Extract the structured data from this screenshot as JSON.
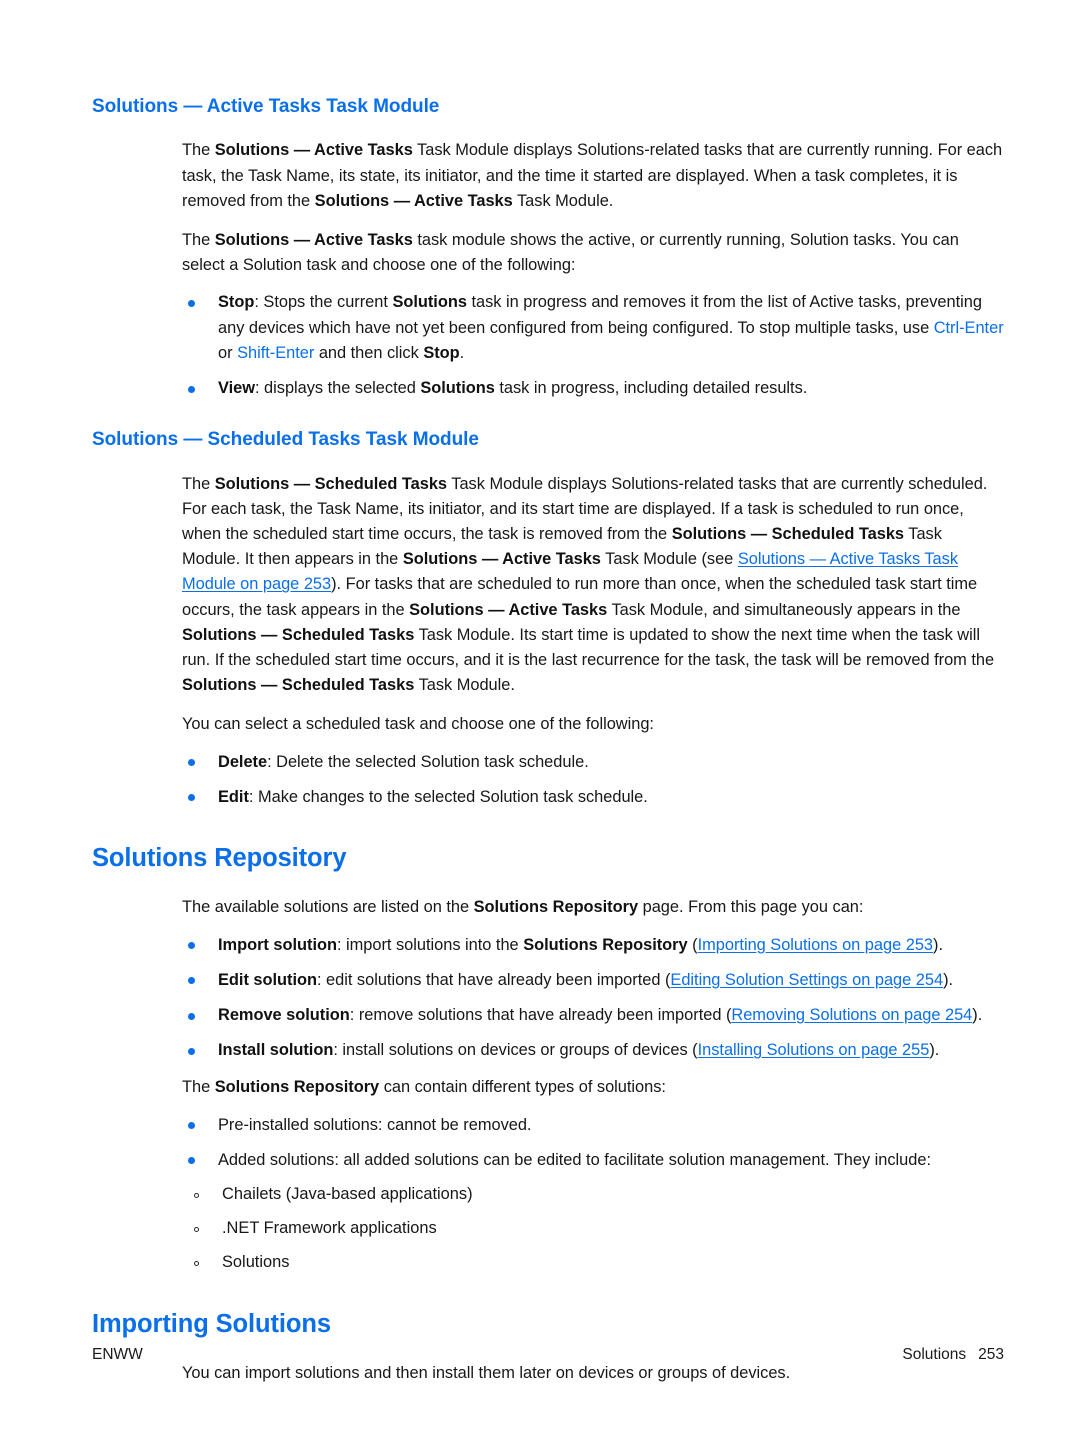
{
  "page": {
    "footer": {
      "left_label": "ENWW",
      "chapter_label": "Solutions",
      "page_number": "253"
    },
    "accent_color": "#0a6fe8",
    "text_color": "#171717"
  },
  "sections": {
    "active_tasks": {
      "heading": "Solutions — Active Tasks Task Module",
      "para1": {
        "t1": "The ",
        "b1": "Solutions — Active Tasks",
        "t2": " Task Module displays Solutions-related tasks that are currently running. For each task, the Task Name, its state, its initiator, and the time it started are displayed. When a task completes, it is removed from the ",
        "b2": "Solutions — Active Tasks",
        "t3": " Task Module."
      },
      "para2": {
        "t1": "The ",
        "b1": "Solutions — Active Tasks",
        "t2": " task module shows the active, or currently running, Solution tasks. You can select a Solution task and choose one of the following:"
      },
      "bullets": [
        {
          "b1": "Stop",
          "t1": ": Stops the current ",
          "b2": "Solutions",
          "t2": " task in progress and removes it from the list of Active tasks, preventing any devices which have not yet been configured from being configured. To stop multiple tasks, use ",
          "key1": "Ctrl-Enter",
          "t3": " or ",
          "key2": "Shift-Enter",
          "t4": " and then click ",
          "b3": "Stop",
          "t5": "."
        },
        {
          "b1": "View",
          "t1": ": displays the selected ",
          "b2": "Solutions",
          "t2": " task in progress, including detailed results."
        }
      ]
    },
    "scheduled_tasks": {
      "heading": "Solutions — Scheduled Tasks Task Module",
      "para1": {
        "t1": "The ",
        "b1": "Solutions — Scheduled Tasks",
        "t2": " Task Module displays Solutions-related tasks that are currently scheduled. For each task, the Task Name, its initiator, and its start time are displayed. If a task is scheduled to run once, when the scheduled start time occurs, the task is removed from the ",
        "b2": "Solutions — Scheduled Tasks",
        "t3": " Task Module. It then appears in the ",
        "b3": "Solutions — Active Tasks",
        "t4": " Task Module (see ",
        "link1": "Solutions — Active Tasks Task Module on page 253",
        "t5": "). For tasks that are scheduled to run more than once, when the scheduled task start time occurs, the task appears in the ",
        "b4": "Solutions — Active Tasks",
        "t6": " Task Module, and simultaneously appears in the ",
        "b5": "Solutions — Scheduled Tasks",
        "t7": " Task Module. Its start time is updated to show the next time when the task will run. If the scheduled start time occurs, and it is the last recurrence for the task, the task will be removed from the ",
        "b6": "Solutions — Scheduled Tasks",
        "t8": " Task Module."
      },
      "para2": "You can select a scheduled task and choose one of the following:",
      "bullets": [
        {
          "b1": "Delete",
          "t1": ": Delete the selected Solution task schedule."
        },
        {
          "b1": "Edit",
          "t1": ": Make changes to the selected Solution task schedule."
        }
      ]
    },
    "solutions_repository": {
      "heading": "Solutions Repository",
      "para1": {
        "t1": "The available solutions are listed on the ",
        "b1": "Solutions Repository",
        "t2": " page. From this page you can:"
      },
      "bullets": [
        {
          "b1": "Import solution",
          "t1": ": import solutions into the ",
          "b2": "Solutions Repository",
          "t2": " (",
          "link1": "Importing Solutions on page 253",
          "t3": ")."
        },
        {
          "b1": "Edit solution",
          "t1": ": edit solutions that have already been imported (",
          "link1": "Editing Solution Settings on page 254",
          "t2": ")."
        },
        {
          "b1": "Remove solution",
          "t1": ": remove solutions that have already been imported (",
          "link1": "Removing Solutions on page 254",
          "t2": ")."
        },
        {
          "b1": "Install solution",
          "t1": ": install solutions on devices or groups of devices (",
          "link1": "Installing Solutions on page 255",
          "t2": ")."
        }
      ],
      "para2": {
        "t1": "The ",
        "b1": "Solutions Repository",
        "t2": " can contain different types of solutions:"
      },
      "types": [
        {
          "text": "Pre-installed solutions: cannot be removed."
        },
        {
          "text": "Added solutions: all added solutions can be edited to facilitate solution management. They include:"
        }
      ],
      "subtypes": [
        "Chailets (Java-based applications)",
        ".NET Framework applications",
        "Solutions"
      ]
    },
    "importing_solutions": {
      "heading": "Importing Solutions",
      "para1": "You can import solutions and then install them later on devices or groups of devices."
    }
  }
}
